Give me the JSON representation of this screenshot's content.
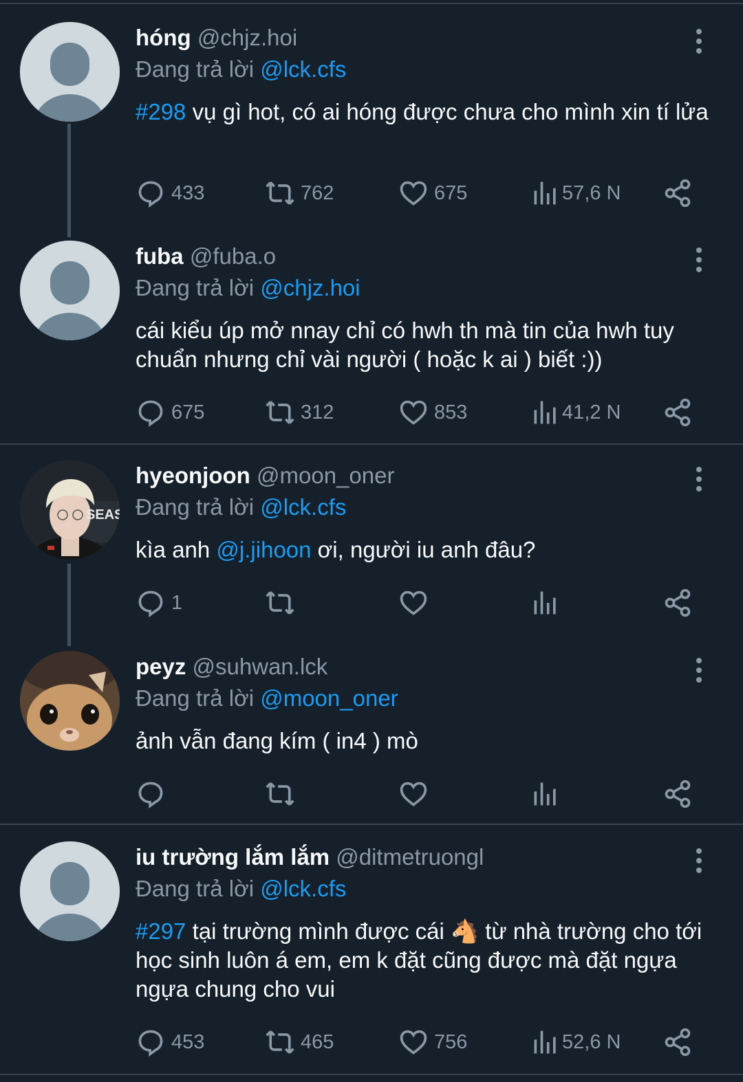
{
  "reply_prefix": "Đang trả lời",
  "tweets": [
    {
      "name": "hóng",
      "handle": "@chjz.hoi",
      "reply_to": "@lck.cfs",
      "tag": "#298",
      "text": " vụ gì hot, có ai hóng được chưa cho mình xin tí lửa",
      "replies": "433",
      "retweets": "762",
      "likes": "675",
      "views": "57,6 N"
    },
    {
      "name": "fuba",
      "handle": "@fuba.o",
      "reply_to": "@chjz.hoi",
      "text": "cái kiểu úp mở nnay chỉ có hwh th mà tin của hwh tuy chuẩn nhưng chỉ vài người ( hoặc k ai ) biết :))",
      "replies": "675",
      "retweets": "312",
      "likes": "853",
      "views": "41,2 N"
    },
    {
      "name": "hyeonjoon",
      "handle": "@moon_oner",
      "reply_to": "@lck.cfs",
      "text_before": "kìa anh ",
      "mention": "@j.jihoon",
      "text_after": " ơi, người iu anh đâu?",
      "avatar_text": "SEASO",
      "replies": "1",
      "retweets": "",
      "likes": "",
      "views": ""
    },
    {
      "name": "peyz",
      "handle": "@suhwan.lck",
      "reply_to": "@moon_oner",
      "text": "ảnh vẫn đang kím ( in4 ) mò",
      "replies": "",
      "retweets": "",
      "likes": "",
      "views": ""
    },
    {
      "name": "iu trường lắm lắm",
      "handle": "@ditmetruongl",
      "reply_to": "@lck.cfs",
      "tag": "#297",
      "text_before": " tại trường mình được cái ",
      "emoji": "🐴",
      "text_after": " từ nhà trường cho tới học sinh luôn á em, em k đặt cũng được mà đặt ngựa ngựa chung cho vui",
      "replies": "453",
      "retweets": "465",
      "likes": "756",
      "views": "52,6 N"
    }
  ],
  "colors": {
    "background": "#15202b",
    "link": "#1d9bf0",
    "secondary": "#8b98a5",
    "divider": "#38444d"
  }
}
